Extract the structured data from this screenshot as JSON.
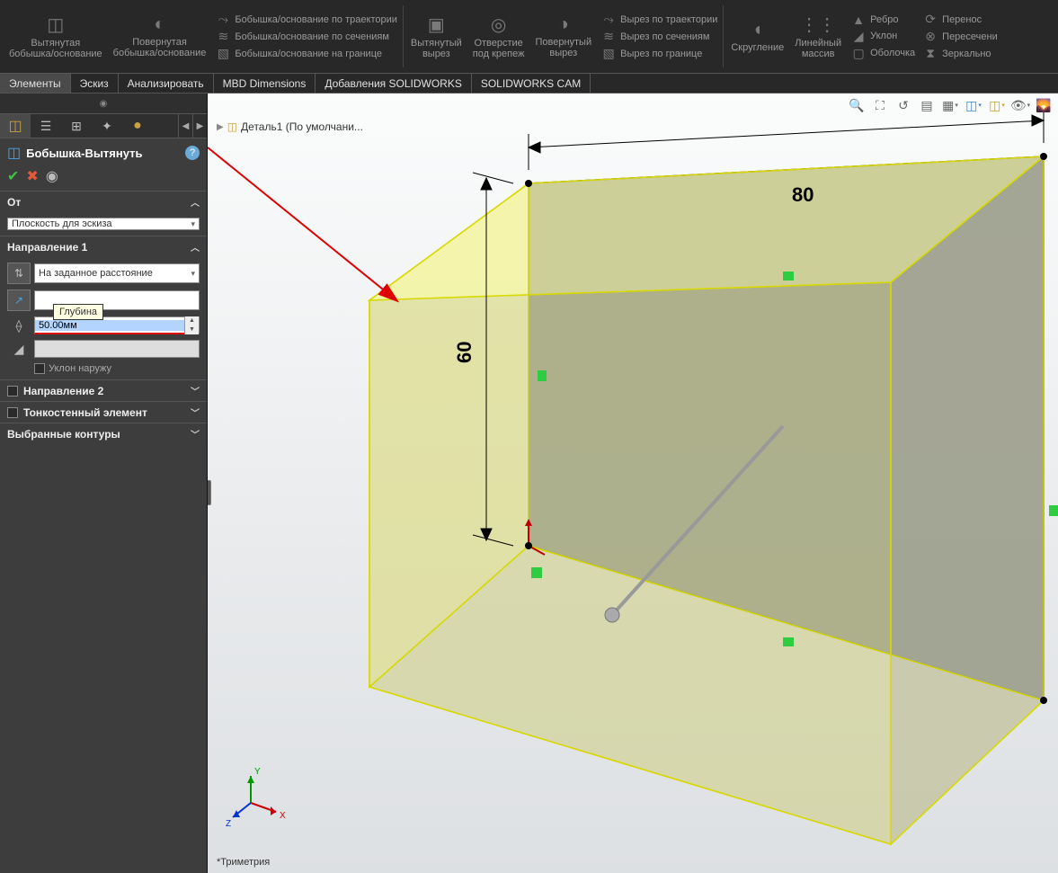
{
  "ribbon": {
    "extruded_boss": "Вытянутая\nбобышка/основание",
    "revolved_boss": "Повернутая\nбобышка/основание",
    "swept_boss": "Бобышка/основание по траектории",
    "lofted_boss": "Бобышка/основание по сечениям",
    "boundary_boss": "Бобышка/основание на границе",
    "extruded_cut": "Вытянутый\nвырез",
    "hole_wizard": "Отверстие\nпод крепеж",
    "revolved_cut": "Повернутый\nвырез",
    "swept_cut": "Вырез по траектории",
    "lofted_cut": "Вырез по сечениям",
    "boundary_cut": "Вырез по границе",
    "fillet": "Скругление",
    "linear_pattern": "Линейный\nмассив",
    "rib": "Ребро",
    "draft": "Уклон",
    "shell": "Оболочка",
    "wrap": "Перенос",
    "intersect": "Пересечени",
    "mirror": "Зеркально"
  },
  "tabs": {
    "features": "Элементы",
    "sketch": "Эскиз",
    "evaluate": "Анализировать",
    "mbd": "MBD Dimensions",
    "addins": "Добавления SOLIDWORKS",
    "cam": "SOLIDWORKS CAM"
  },
  "breadcrumb": {
    "part": "Деталь1 (По умолчани..."
  },
  "feature_panel": {
    "title": "Бобышка-Вытянуть",
    "from_label": "От",
    "from_value": "Плоскость для эскиза",
    "dir1_label": "Направление 1",
    "end_condition": "На заданное расстояние",
    "depth_tooltip": "Глубина",
    "depth_value": "50.00мм",
    "draft_out": "Уклон наружу",
    "dir2_label": "Направление 2",
    "thin_label": "Тонкостенный элемент",
    "contours_label": "Выбранные контуры"
  },
  "dims": {
    "width": "80",
    "height": "60"
  },
  "status": "*Триметрия",
  "triad": {
    "x": "X",
    "y": "Y",
    "z": "Z"
  }
}
